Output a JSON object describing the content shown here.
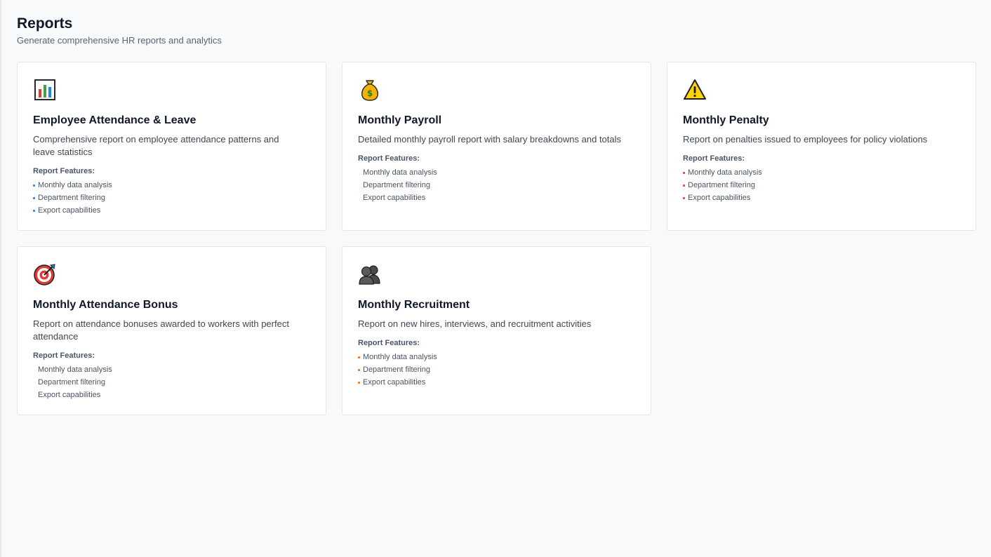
{
  "header": {
    "title": "Reports",
    "subtitle": "Generate comprehensive HR reports and analytics"
  },
  "features_label": "Report Features:",
  "cards": [
    {
      "icon": "bar-chart-icon",
      "title": "Employee Attendance & Leave",
      "description": "Comprehensive report on employee attendance patterns and leave statistics",
      "bullet_color": "#3b82f6",
      "features": [
        "Monthly data analysis",
        "Department filtering",
        "Export capabilities"
      ]
    },
    {
      "icon": "money-bag-icon",
      "title": "Monthly Payroll",
      "description": "Detailed monthly payroll report with salary breakdowns and totals",
      "bullet_color": "#ffffff",
      "features": [
        "Monthly data analysis",
        "Department filtering",
        "Export capabilities"
      ]
    },
    {
      "icon": "warning-icon",
      "title": "Monthly Penalty",
      "description": "Report on penalties issued to employees for policy violations",
      "bullet_color": "#ef4444",
      "features": [
        "Monthly data analysis",
        "Department filtering",
        "Export capabilities"
      ]
    },
    {
      "icon": "target-icon",
      "title": "Monthly Attendance Bonus",
      "description": "Report on attendance bonuses awarded to workers with perfect attendance",
      "bullet_color": "#ffffff",
      "features": [
        "Monthly data analysis",
        "Department filtering",
        "Export capabilities"
      ]
    },
    {
      "icon": "people-icon",
      "title": "Monthly Recruitment",
      "description": "Report on new hires, interviews, and recruitment activities",
      "bullet_color": "#f97316",
      "features": [
        "Monthly data analysis",
        "Department filtering",
        "Export capabilities"
      ]
    }
  ]
}
